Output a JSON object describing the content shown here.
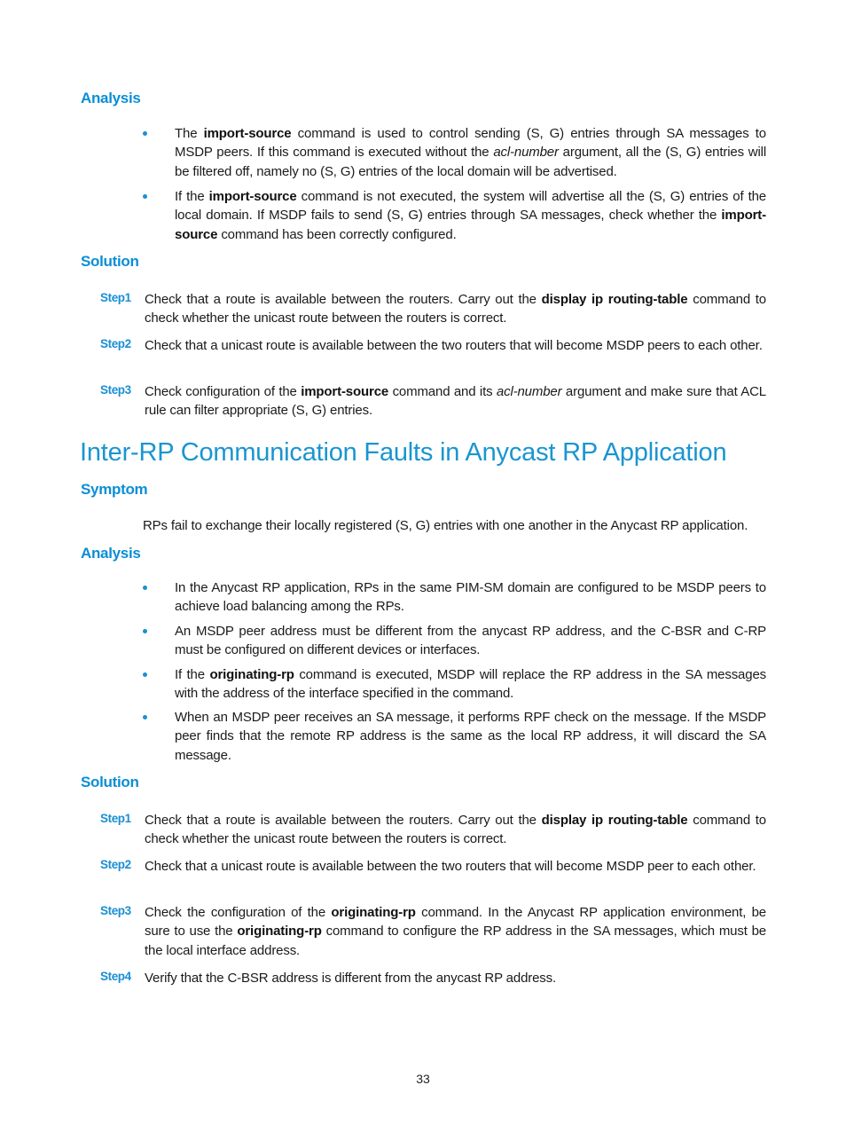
{
  "sections": {
    "analysis1": {
      "heading": "Analysis",
      "bullets": [
        {
          "parts": [
            {
              "t": "The "
            },
            {
              "b": "import-source"
            },
            {
              "t": " command is used to control sending (S, G) entries through SA messages to MSDP peers. If this command is executed without the "
            },
            {
              "i": "acl-number"
            },
            {
              "t": " argument, all the (S, G) entries will be filtered off, namely no (S, G) entries of the local domain will be advertised."
            }
          ]
        },
        {
          "parts": [
            {
              "t": "If the "
            },
            {
              "b": "import-source"
            },
            {
              "t": " command is not executed, the system will advertise all the (S, G) entries of the local domain. If MSDP fails to send (S, G) entries through SA messages, check whether the "
            },
            {
              "b": "import-source"
            },
            {
              "t": " command has been correctly configured."
            }
          ]
        }
      ]
    },
    "solution1": {
      "heading": "Solution",
      "steps": [
        {
          "label": "Step1",
          "parts": [
            {
              "t": "Check that a route is available between the routers. Carry out the "
            },
            {
              "b": "display ip routing-table"
            },
            {
              "t": " command to check whether the unicast route between the routers is correct."
            }
          ]
        },
        {
          "label": "Step2",
          "parts": [
            {
              "t": "Check that a unicast route is available between the two routers that will become MSDP peers to each other."
            }
          ]
        },
        {
          "label": "Step3",
          "parts": [
            {
              "t": "Check configuration of the "
            },
            {
              "b": "import-source"
            },
            {
              "t": " command and its "
            },
            {
              "i": "acl-number"
            },
            {
              "t": " argument and make sure that ACL rule can filter appropriate (S, G) entries."
            }
          ]
        }
      ]
    },
    "chapter_title": "Inter-RP Communication Faults in Anycast RP Application",
    "symptom": {
      "heading": "Symptom",
      "text": "RPs fail to exchange their locally registered (S, G) entries with one another in the Anycast RP application."
    },
    "analysis2": {
      "heading": "Analysis",
      "bullets": [
        {
          "parts": [
            {
              "t": "In the Anycast RP application, RPs in the same PIM-SM domain are configured to be MSDP peers to achieve load balancing among the RPs."
            }
          ]
        },
        {
          "parts": [
            {
              "t": "An MSDP peer address must be different from the anycast RP address, and the C-BSR and C-RP must be configured on different devices or interfaces."
            }
          ]
        },
        {
          "parts": [
            {
              "t": "If the "
            },
            {
              "b": "originating-rp"
            },
            {
              "t": " command is executed, MSDP will replace the RP address in the SA messages with the address of the interface specified in the command."
            }
          ]
        },
        {
          "parts": [
            {
              "t": "When an MSDP peer receives an SA message, it performs RPF check on the message. If the MSDP peer finds that the remote RP address is the same as the local RP address, it will discard the SA message."
            }
          ]
        }
      ]
    },
    "solution2": {
      "heading": "Solution",
      "steps": [
        {
          "label": "Step1",
          "parts": [
            {
              "t": "Check that a route is available between the routers. Carry out the "
            },
            {
              "b": "display ip routing-table"
            },
            {
              "t": " command to check whether the unicast route between the routers is correct."
            }
          ]
        },
        {
          "label": "Step2",
          "parts": [
            {
              "t": "Check that a unicast route is available between the two routers that will become MSDP peer to each other."
            }
          ]
        },
        {
          "label": "Step3",
          "parts": [
            {
              "t": "Check the configuration of the "
            },
            {
              "b": "originating-rp"
            },
            {
              "t": " command. In the Anycast RP application environment, be sure to use the "
            },
            {
              "b": "originating-rp"
            },
            {
              "t": " command to configure the RP address in the SA messages, which must be the local interface address."
            }
          ]
        },
        {
          "label": "Step4",
          "parts": [
            {
              "t": "Verify that the C-BSR address is different from the anycast RP address."
            }
          ]
        }
      ]
    }
  },
  "page_number": "33",
  "colors": {
    "heading": "#0a8ed6",
    "chapter": "#1a95d0",
    "bullet": "#1a8fd3",
    "step_label": "#1a8fd3"
  }
}
